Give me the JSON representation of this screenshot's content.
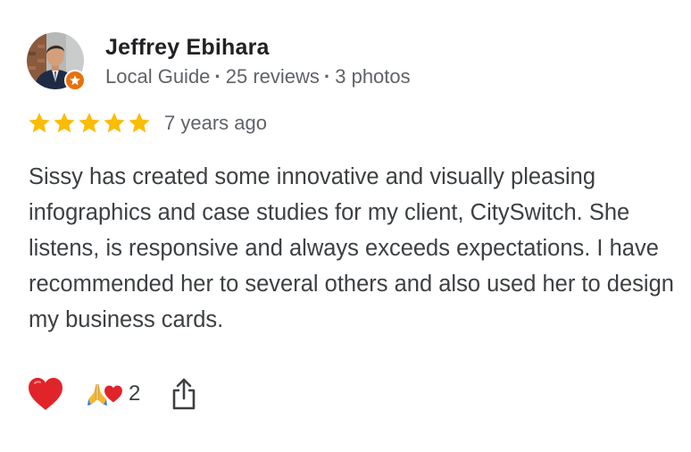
{
  "reviewer": {
    "name": "Jeffrey Ebihara",
    "badge": "Local Guide",
    "reviews": "25 reviews",
    "photos": "3 photos",
    "separator": "·"
  },
  "review": {
    "rating": 5,
    "max_rating": 5,
    "time_ago": "7 years ago",
    "text": "Sissy has created some innovative and visually pleasing infographics and case studies for my client, CitySwitch. She listens, is responsive and always exceeds expectations. I have recommended her to several others and also used her to design my business cards."
  },
  "actions": {
    "heart_icon": "red-heart-icon",
    "reaction_icons": [
      "folded-hands-icon",
      "red-heart-icon"
    ],
    "reaction_count": "2",
    "share_icon": "share-icon"
  },
  "colors": {
    "star": "#fbbc04",
    "guide_badge": "#e8710a",
    "heart": "#e0242a",
    "name": "#202124",
    "meta": "#5f6368",
    "body_text": "#3c4043"
  }
}
